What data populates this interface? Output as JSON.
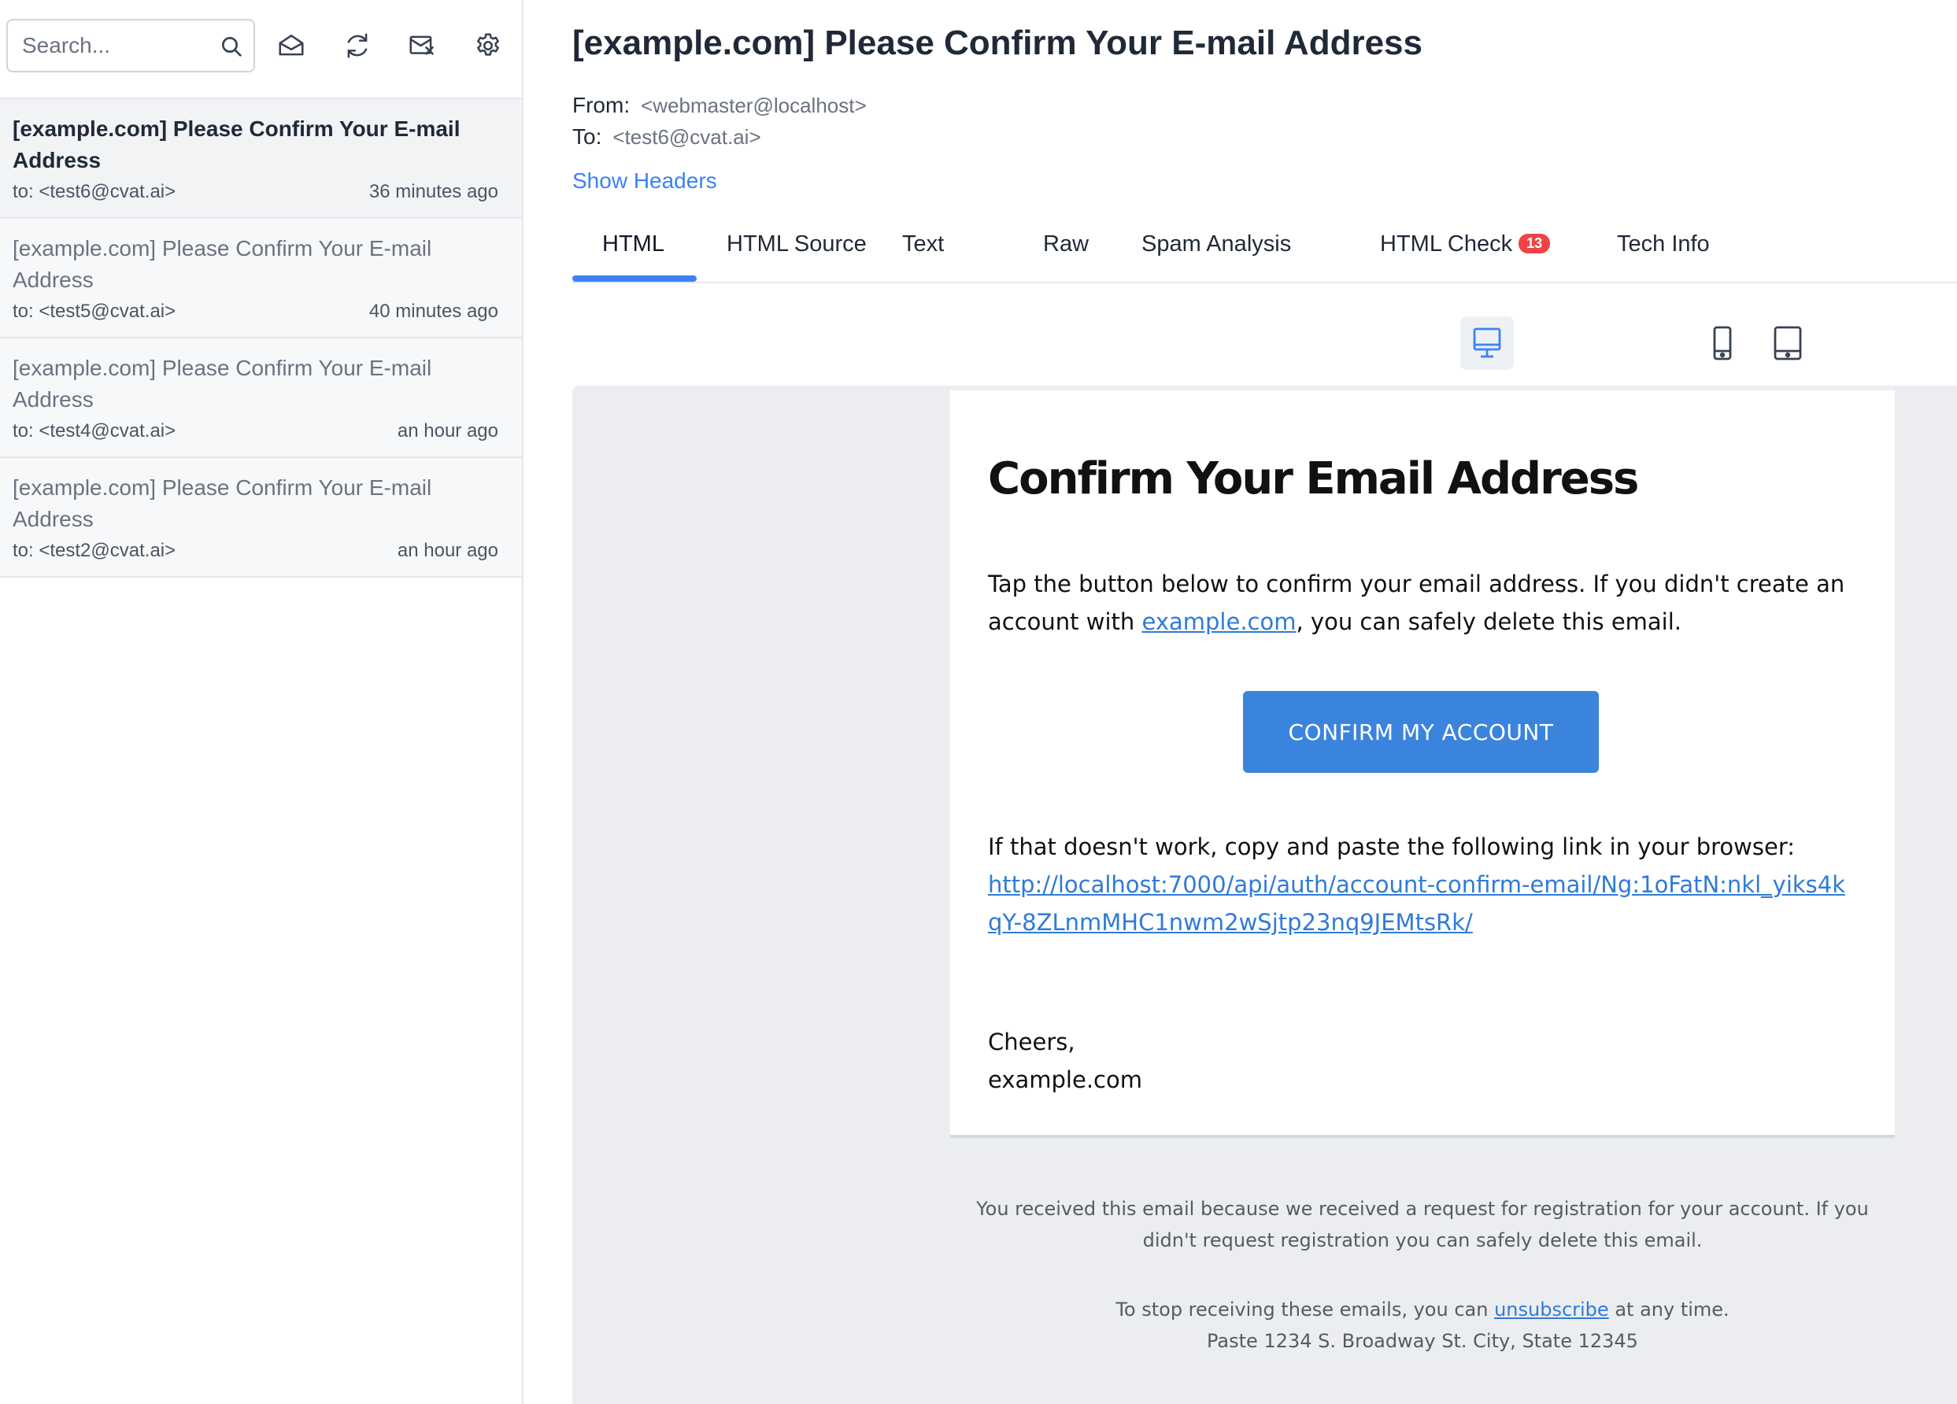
{
  "sidebar": {
    "search": {
      "placeholder": "Search..."
    },
    "toolbar_icons": [
      "search-icon",
      "mark-read-icon",
      "refresh-icon",
      "clear-mailbox-icon",
      "settings-icon"
    ],
    "messages": [
      {
        "subject": "[example.com] Please Confirm Your E-mail Address",
        "to": "to: <test6@cvat.ai>",
        "time": "36 minutes ago",
        "active": true
      },
      {
        "subject": "[example.com] Please Confirm Your E-mail Address",
        "to": "to: <test5@cvat.ai>",
        "time": "40 minutes ago",
        "active": false
      },
      {
        "subject": "[example.com] Please Confirm Your E-mail Address",
        "to": "to: <test4@cvat.ai>",
        "time": "an hour ago",
        "active": false
      },
      {
        "subject": "[example.com] Please Confirm Your E-mail Address",
        "to": "to: <test2@cvat.ai>",
        "time": "an hour ago",
        "active": false
      }
    ]
  },
  "message": {
    "title": "[example.com] Please Confirm Your E-mail Address",
    "from_label": "From:",
    "from_value": "<webmaster@localhost>",
    "to_label": "To:",
    "to_value": "<test6@cvat.ai>",
    "show_headers": "Show Headers"
  },
  "tabs": [
    {
      "label": "HTML",
      "active": true
    },
    {
      "label": "HTML Source"
    },
    {
      "label": "Text"
    },
    {
      "label": "Raw"
    },
    {
      "label": "Spam Analysis"
    },
    {
      "label": "HTML Check",
      "badge": "13"
    },
    {
      "label": "Tech Info"
    }
  ],
  "device_views": [
    {
      "icon": "mobile-icon",
      "active": false
    },
    {
      "icon": "tablet-icon",
      "active": false
    },
    {
      "icon": "desktop-icon",
      "active": true
    }
  ],
  "email": {
    "heading": "Confirm Your Email Address",
    "para_before": "Tap the button below to confirm your email address. If you didn't create an account with ",
    "para_link": "example.com",
    "para_after": ", you can safely delete this email.",
    "button": "CONFIRM MY ACCOUNT",
    "fallback_text": "If that doesn't work, copy and paste the following link in your browser:",
    "fallback_link": "http://localhost:7000/api/auth/account-confirm-email/Ng:1oFatN:nkl_yiks4kqY-8ZLnmMHC1nwm2wSjtp23nq9JEMtsRk/",
    "signoff": "Cheers,",
    "signature": "example.com"
  },
  "footer": {
    "note": "You received this email because we received a request for registration for your account. If you didn't request registration you can safely delete this email.",
    "stop_before": "To stop receiving these emails, you can ",
    "stop_link": "unsubscribe",
    "stop_after": " at any time.",
    "address": "Paste 1234 S. Broadway St. City, State 12345"
  },
  "colors": {
    "accent": "#3b82f6",
    "button": "#3b84de",
    "badge": "#ef4444",
    "preview_bg": "#ebedf0"
  }
}
